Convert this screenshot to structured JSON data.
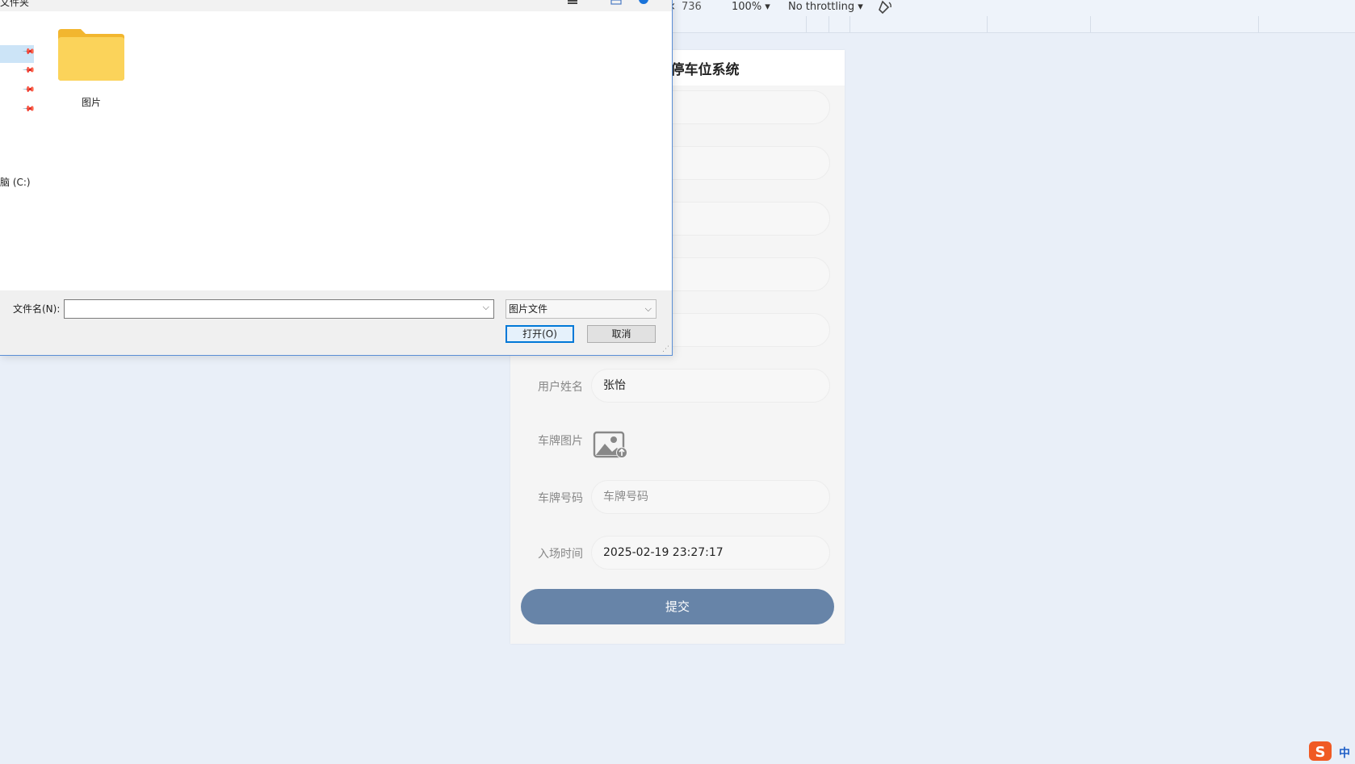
{
  "devtools": {
    "close_symbol": "×",
    "height_value": "736",
    "zoom": "100% ▾",
    "throttling": "No throttling ▾",
    "rotate_icon": "rotate-icon"
  },
  "dialog": {
    "title_fragment": "文件夹",
    "drive_label": "脑 (C:)",
    "folder_name": "图片",
    "filename_label": "文件名(N):",
    "filename_value": "",
    "filter_value": "图片文件",
    "open_button": "打开(O)",
    "cancel_button": "取消"
  },
  "app": {
    "title": "智慧共享停车位系统",
    "fields": [
      {
        "label": "",
        "value": "",
        "placeholder": ""
      },
      {
        "label": "",
        "value": "",
        "placeholder": ""
      },
      {
        "label": "",
        "value": "",
        "placeholder": ""
      },
      {
        "label": "",
        "value": "",
        "placeholder": ""
      },
      {
        "label": "",
        "value": "",
        "placeholder": ""
      },
      {
        "label": "用户姓名",
        "value": "张怡",
        "placeholder": ""
      },
      {
        "label": "车牌图片",
        "value": "",
        "placeholder": ""
      },
      {
        "label": "车牌号码",
        "value": "",
        "placeholder": "车牌号码"
      },
      {
        "label": "入场时间",
        "value": "2025-02-19 23:27:17",
        "placeholder": ""
      }
    ],
    "submit_label": "提交"
  },
  "ime": {
    "label": "中"
  },
  "colors": {
    "submit": "#6784a8",
    "background": "#e9eff8",
    "dialog_border": "#5b8fd6",
    "primary_button_border": "#0078d7",
    "folder": "#f8c948"
  }
}
